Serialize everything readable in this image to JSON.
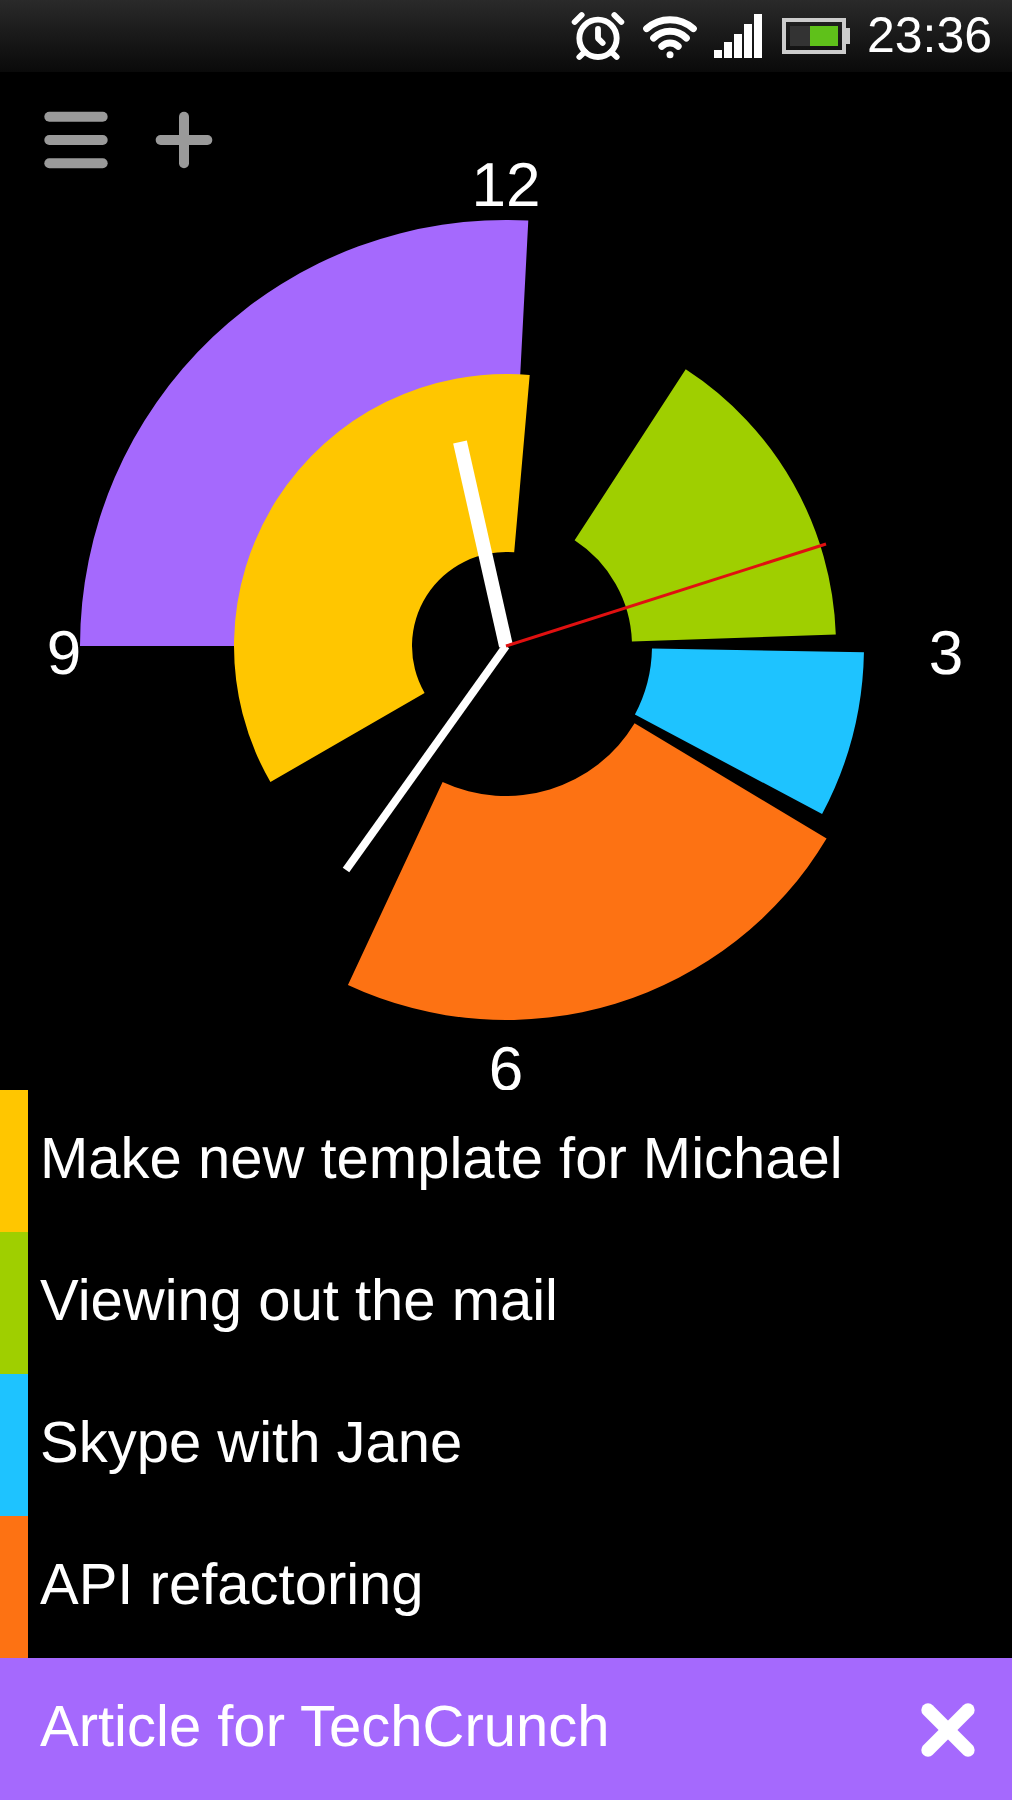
{
  "status_bar": {
    "time": "23:36"
  },
  "clock": {
    "dial_labels": [
      "12",
      "3",
      "6",
      "9"
    ]
  },
  "tasks": [
    {
      "name": "Make new template for Michael",
      "color": "#ffc600"
    },
    {
      "name": "Viewing out the mail",
      "color": "#9fcf00"
    },
    {
      "name": "Skype with Jane",
      "color": "#1ec3ff"
    },
    {
      "name": "API refactoring",
      "color": "#fd7213"
    }
  ],
  "current_task": {
    "name": "Article for TechCrunch",
    "color": "#a569fd"
  }
}
